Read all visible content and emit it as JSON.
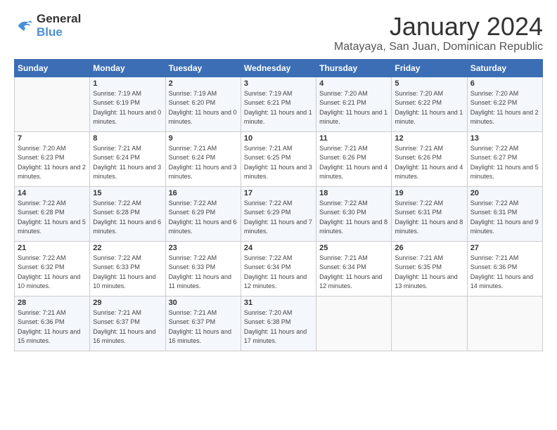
{
  "logo": {
    "line1": "General",
    "line2": "Blue"
  },
  "title": "January 2024",
  "location": "Matayaya, San Juan, Dominican Republic",
  "weekdays": [
    "Sunday",
    "Monday",
    "Tuesday",
    "Wednesday",
    "Thursday",
    "Friday",
    "Saturday"
  ],
  "weeks": [
    [
      {
        "day": "",
        "sunrise": "",
        "sunset": "",
        "daylight": ""
      },
      {
        "day": "1",
        "sunrise": "Sunrise: 7:19 AM",
        "sunset": "Sunset: 6:19 PM",
        "daylight": "Daylight: 11 hours and 0 minutes."
      },
      {
        "day": "2",
        "sunrise": "Sunrise: 7:19 AM",
        "sunset": "Sunset: 6:20 PM",
        "daylight": "Daylight: 11 hours and 0 minutes."
      },
      {
        "day": "3",
        "sunrise": "Sunrise: 7:19 AM",
        "sunset": "Sunset: 6:21 PM",
        "daylight": "Daylight: 11 hours and 1 minute."
      },
      {
        "day": "4",
        "sunrise": "Sunrise: 7:20 AM",
        "sunset": "Sunset: 6:21 PM",
        "daylight": "Daylight: 11 hours and 1 minute."
      },
      {
        "day": "5",
        "sunrise": "Sunrise: 7:20 AM",
        "sunset": "Sunset: 6:22 PM",
        "daylight": "Daylight: 11 hours and 1 minute."
      },
      {
        "day": "6",
        "sunrise": "Sunrise: 7:20 AM",
        "sunset": "Sunset: 6:22 PM",
        "daylight": "Daylight: 11 hours and 2 minutes."
      }
    ],
    [
      {
        "day": "7",
        "sunrise": "Sunrise: 7:20 AM",
        "sunset": "Sunset: 6:23 PM",
        "daylight": "Daylight: 11 hours and 2 minutes."
      },
      {
        "day": "8",
        "sunrise": "Sunrise: 7:21 AM",
        "sunset": "Sunset: 6:24 PM",
        "daylight": "Daylight: 11 hours and 3 minutes."
      },
      {
        "day": "9",
        "sunrise": "Sunrise: 7:21 AM",
        "sunset": "Sunset: 6:24 PM",
        "daylight": "Daylight: 11 hours and 3 minutes."
      },
      {
        "day": "10",
        "sunrise": "Sunrise: 7:21 AM",
        "sunset": "Sunset: 6:25 PM",
        "daylight": "Daylight: 11 hours and 3 minutes."
      },
      {
        "day": "11",
        "sunrise": "Sunrise: 7:21 AM",
        "sunset": "Sunset: 6:26 PM",
        "daylight": "Daylight: 11 hours and 4 minutes."
      },
      {
        "day": "12",
        "sunrise": "Sunrise: 7:21 AM",
        "sunset": "Sunset: 6:26 PM",
        "daylight": "Daylight: 11 hours and 4 minutes."
      },
      {
        "day": "13",
        "sunrise": "Sunrise: 7:22 AM",
        "sunset": "Sunset: 6:27 PM",
        "daylight": "Daylight: 11 hours and 5 minutes."
      }
    ],
    [
      {
        "day": "14",
        "sunrise": "Sunrise: 7:22 AM",
        "sunset": "Sunset: 6:28 PM",
        "daylight": "Daylight: 11 hours and 5 minutes."
      },
      {
        "day": "15",
        "sunrise": "Sunrise: 7:22 AM",
        "sunset": "Sunset: 6:28 PM",
        "daylight": "Daylight: 11 hours and 6 minutes."
      },
      {
        "day": "16",
        "sunrise": "Sunrise: 7:22 AM",
        "sunset": "Sunset: 6:29 PM",
        "daylight": "Daylight: 11 hours and 6 minutes."
      },
      {
        "day": "17",
        "sunrise": "Sunrise: 7:22 AM",
        "sunset": "Sunset: 6:29 PM",
        "daylight": "Daylight: 11 hours and 7 minutes."
      },
      {
        "day": "18",
        "sunrise": "Sunrise: 7:22 AM",
        "sunset": "Sunset: 6:30 PM",
        "daylight": "Daylight: 11 hours and 8 minutes."
      },
      {
        "day": "19",
        "sunrise": "Sunrise: 7:22 AM",
        "sunset": "Sunset: 6:31 PM",
        "daylight": "Daylight: 11 hours and 8 minutes."
      },
      {
        "day": "20",
        "sunrise": "Sunrise: 7:22 AM",
        "sunset": "Sunset: 6:31 PM",
        "daylight": "Daylight: 11 hours and 9 minutes."
      }
    ],
    [
      {
        "day": "21",
        "sunrise": "Sunrise: 7:22 AM",
        "sunset": "Sunset: 6:32 PM",
        "daylight": "Daylight: 11 hours and 10 minutes."
      },
      {
        "day": "22",
        "sunrise": "Sunrise: 7:22 AM",
        "sunset": "Sunset: 6:33 PM",
        "daylight": "Daylight: 11 hours and 10 minutes."
      },
      {
        "day": "23",
        "sunrise": "Sunrise: 7:22 AM",
        "sunset": "Sunset: 6:33 PM",
        "daylight": "Daylight: 11 hours and 11 minutes."
      },
      {
        "day": "24",
        "sunrise": "Sunrise: 7:22 AM",
        "sunset": "Sunset: 6:34 PM",
        "daylight": "Daylight: 11 hours and 12 minutes."
      },
      {
        "day": "25",
        "sunrise": "Sunrise: 7:21 AM",
        "sunset": "Sunset: 6:34 PM",
        "daylight": "Daylight: 11 hours and 12 minutes."
      },
      {
        "day": "26",
        "sunrise": "Sunrise: 7:21 AM",
        "sunset": "Sunset: 6:35 PM",
        "daylight": "Daylight: 11 hours and 13 minutes."
      },
      {
        "day": "27",
        "sunrise": "Sunrise: 7:21 AM",
        "sunset": "Sunset: 6:36 PM",
        "daylight": "Daylight: 11 hours and 14 minutes."
      }
    ],
    [
      {
        "day": "28",
        "sunrise": "Sunrise: 7:21 AM",
        "sunset": "Sunset: 6:36 PM",
        "daylight": "Daylight: 11 hours and 15 minutes."
      },
      {
        "day": "29",
        "sunrise": "Sunrise: 7:21 AM",
        "sunset": "Sunset: 6:37 PM",
        "daylight": "Daylight: 11 hours and 16 minutes."
      },
      {
        "day": "30",
        "sunrise": "Sunrise: 7:21 AM",
        "sunset": "Sunset: 6:37 PM",
        "daylight": "Daylight: 11 hours and 16 minutes."
      },
      {
        "day": "31",
        "sunrise": "Sunrise: 7:20 AM",
        "sunset": "Sunset: 6:38 PM",
        "daylight": "Daylight: 11 hours and 17 minutes."
      },
      {
        "day": "",
        "sunrise": "",
        "sunset": "",
        "daylight": ""
      },
      {
        "day": "",
        "sunrise": "",
        "sunset": "",
        "daylight": ""
      },
      {
        "day": "",
        "sunrise": "",
        "sunset": "",
        "daylight": ""
      }
    ]
  ]
}
